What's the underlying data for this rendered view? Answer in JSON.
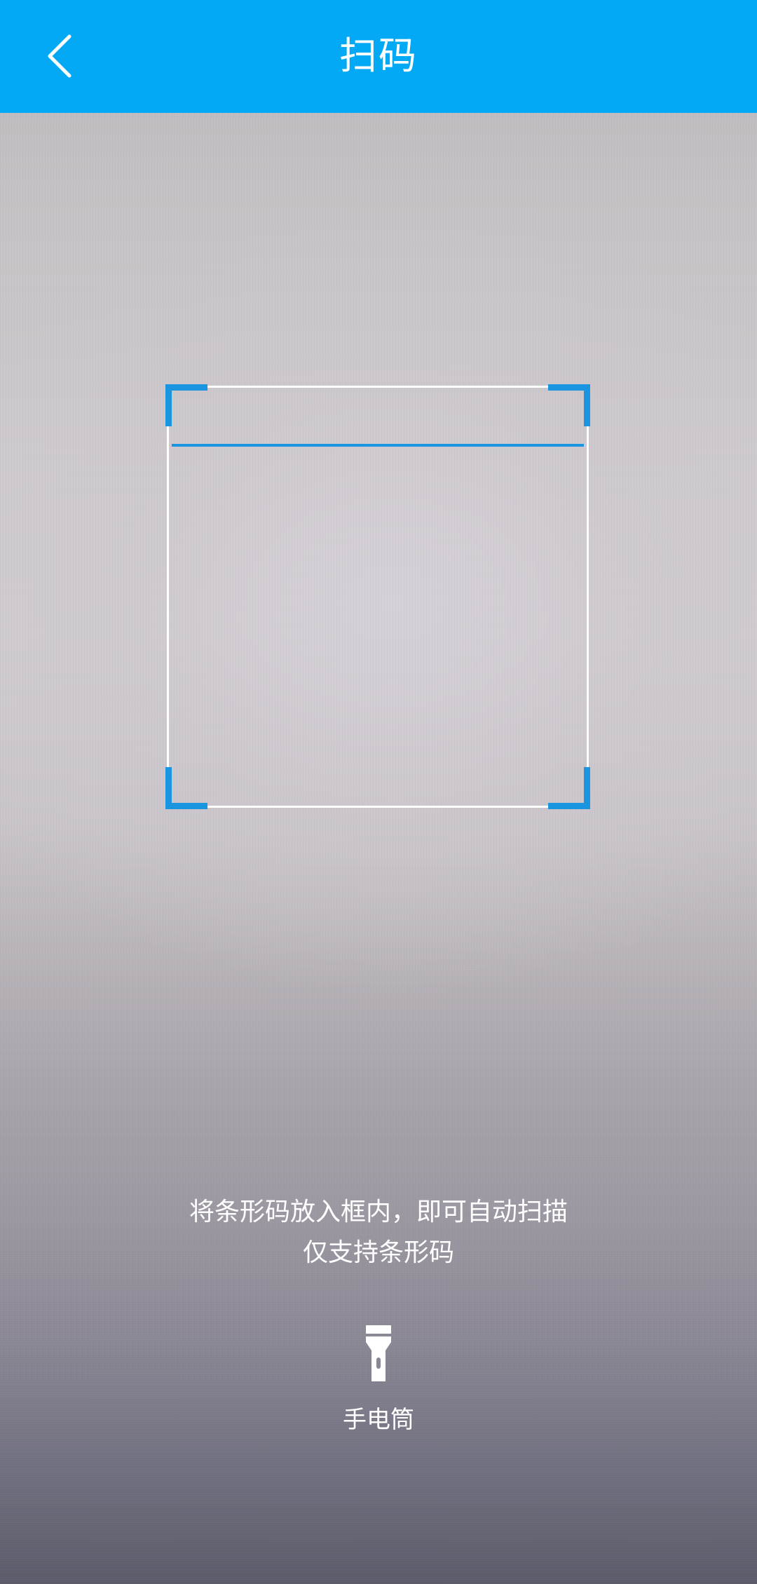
{
  "header": {
    "title": "扫码",
    "back_icon": "chevron-left-icon",
    "background_color": "#03a9f4"
  },
  "scanner": {
    "frame_color": "#ffffff",
    "corner_color": "#1a96e0",
    "scan_line_color": "#1a96e0"
  },
  "hint": {
    "line1": "将条形码放入框内，即可自动扫描",
    "line2": "仅支持条形码"
  },
  "flashlight": {
    "icon": "flashlight-icon",
    "label": "手电筒"
  }
}
